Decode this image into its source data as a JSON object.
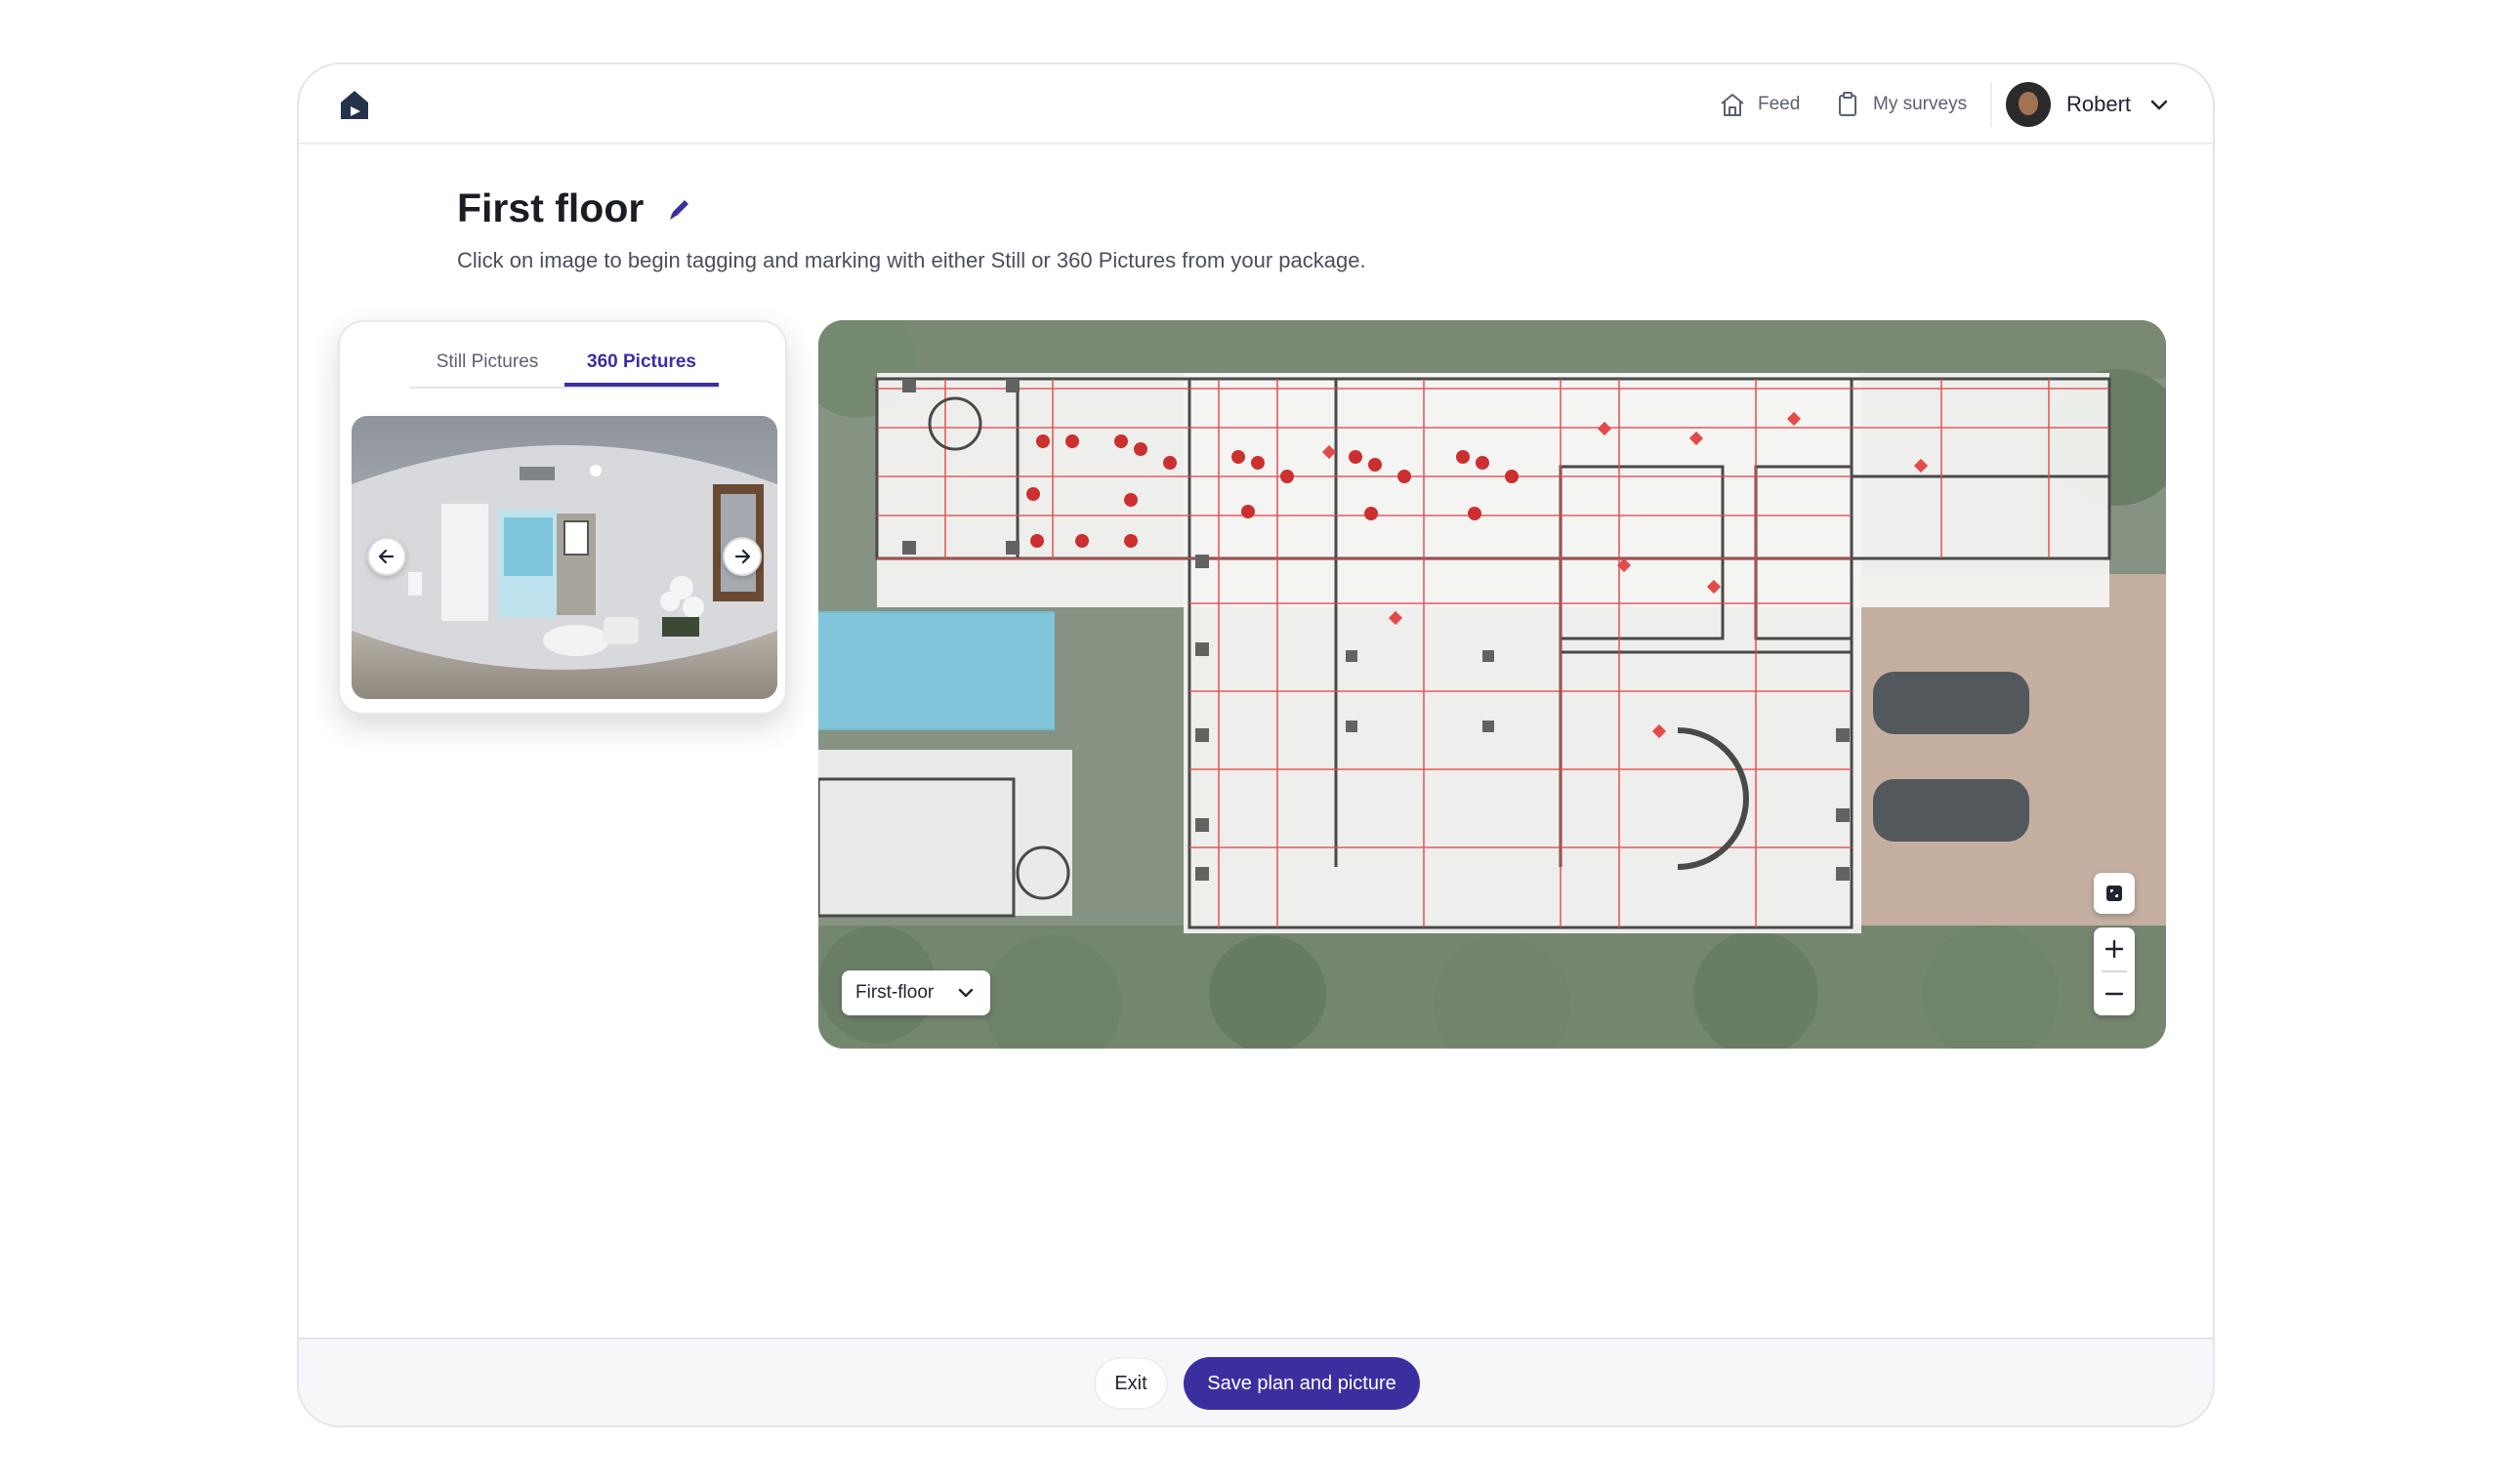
{
  "header": {
    "nav": [
      {
        "label": "Feed",
        "icon": "home-icon"
      },
      {
        "label": "My surveys",
        "icon": "clipboard-icon"
      }
    ],
    "user": {
      "name": "Robert"
    }
  },
  "page": {
    "title": "First floor",
    "subtitle": "Click on image to begin tagging and marking with either Still or 360 Pictures from your package."
  },
  "picture_panel": {
    "tabs": [
      {
        "label": "Still Pictures",
        "active": false
      },
      {
        "label": "360 Pictures",
        "active": true
      }
    ]
  },
  "plan": {
    "floor_select": {
      "value": "First-floor"
    }
  },
  "footer": {
    "exit_label": "Exit",
    "save_label": "Save plan and picture"
  },
  "colors": {
    "accent": "#3b2fa0",
    "marker": "#c81e1e",
    "plan_lines": "#e23b3b"
  }
}
